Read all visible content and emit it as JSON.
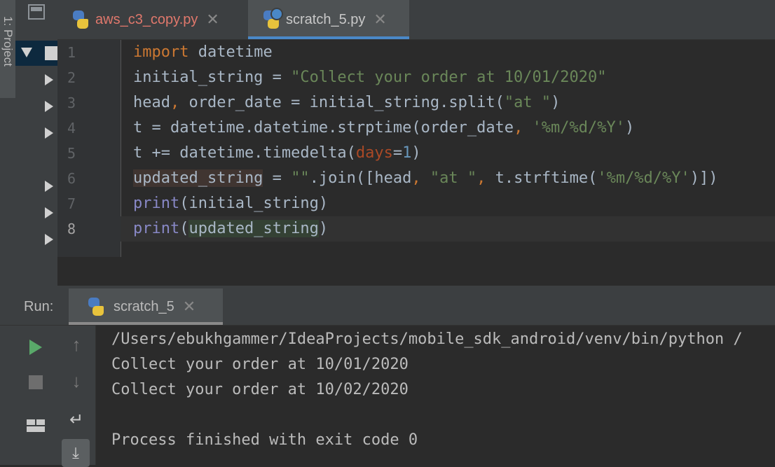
{
  "sidebar": {
    "project_tab_label": "1: Project"
  },
  "tabs": [
    {
      "label": "aws_c3_copy.py",
      "active": false,
      "color": "#e0786c"
    },
    {
      "label": "scratch_5.py",
      "active": true,
      "color": "#c8c8c8"
    }
  ],
  "editor": {
    "line_numbers": [
      "1",
      "2",
      "3",
      "4",
      "5",
      "6",
      "7",
      "8"
    ],
    "current_line": "8",
    "code": {
      "l1": {
        "kw": "import",
        "rest": " datetime"
      },
      "l2": {
        "a": "initial_string = ",
        "str": "\"Collect your order at 10/01/2020\""
      },
      "l3": {
        "a": "head",
        "comma": ",",
        "b": " order_date = initial_string.split(",
        "str": "\"at \"",
        "c": ")"
      },
      "l4": {
        "a": "t = datetime.datetime.strptime(order_date",
        "comma": ",",
        "sp": " ",
        "str": "'%m/%d/%Y'",
        "c": ")"
      },
      "l5": {
        "a": "t += datetime.timedelta(",
        "param": "days",
        "eq": "=",
        "num": "1",
        "c": ")"
      },
      "l6": {
        "var": "updated_string",
        "a": " = ",
        "str1": "\"\"",
        "b": ".join([head",
        "comma1": ",",
        "sp1": " ",
        "str2": "\"at \"",
        "comma2": ",",
        "c": " t.strftime(",
        "str3": "'%m/%d/%Y'",
        "d": ")])"
      },
      "l7": {
        "fn": "print",
        "a": "(initial_string)"
      },
      "l8": {
        "fn": "print",
        "a": "(",
        "var": "updated_string",
        "b": ")"
      }
    }
  },
  "run_panel": {
    "label": "Run:",
    "tab_label": "scratch_5",
    "output": [
      "/Users/ebukhgammer/IdeaProjects/mobile_sdk_android/venv/bin/python /",
      "Collect your order at 10/01/2020",
      "Collect your order at 10/02/2020",
      "",
      "Process finished with exit code 0"
    ]
  },
  "colors": {
    "keyword": "#cc7832",
    "string": "#6a8759",
    "builtin": "#8888c6",
    "parameter": "#aa4926",
    "number": "#6897bb",
    "run_green": "#59a869",
    "accent_blue": "#4a88c7"
  },
  "icons": {
    "project_view": "project-window-icon",
    "python_file": "python-file-icon",
    "scratch_file": "python-scratch-icon",
    "run": "play-icon",
    "stop": "stop-icon",
    "layout": "restore-layout-icon",
    "up": "arrow-up-icon",
    "down": "arrow-down-icon",
    "soft_wrap": "soft-wrap-icon",
    "scroll_end": "scroll-to-end-icon"
  }
}
